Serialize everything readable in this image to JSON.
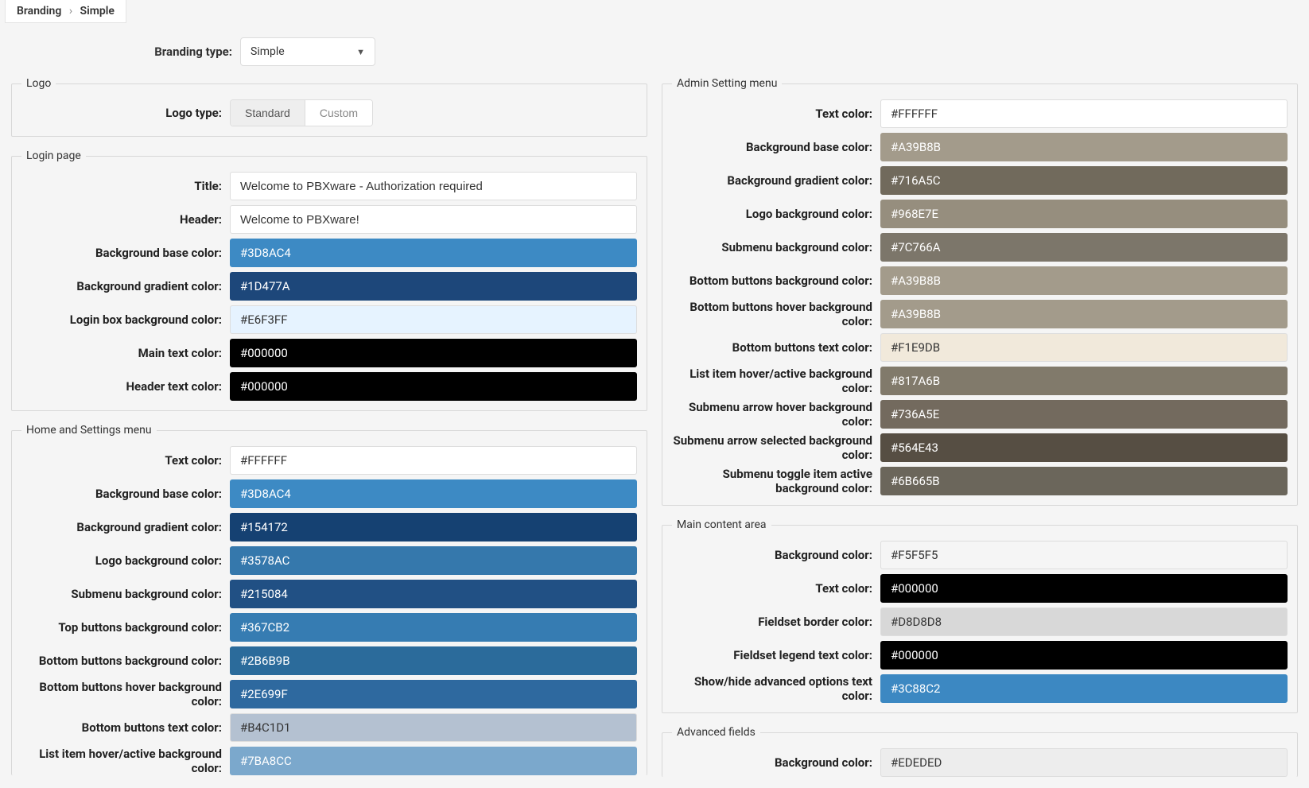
{
  "breadcrumb": {
    "root": "Branding",
    "leaf": "Simple"
  },
  "brandingType": {
    "label": "Branding type:",
    "value": "Simple"
  },
  "logo": {
    "legend": "Logo",
    "typeLabel": "Logo type:",
    "standard": "Standard",
    "custom": "Custom"
  },
  "loginPage": {
    "legend": "Login page",
    "fields": [
      {
        "label": "Title:",
        "type": "text",
        "value": "Welcome to PBXware - Authorization required"
      },
      {
        "label": "Header:",
        "type": "text",
        "value": "Welcome to PBXware!"
      },
      {
        "label": "Background base color:",
        "type": "color",
        "value": "#3D8AC4"
      },
      {
        "label": "Background gradient color:",
        "type": "color",
        "value": "#1D477A"
      },
      {
        "label": "Login box background color:",
        "type": "color",
        "value": "#E6F3FF"
      },
      {
        "label": "Main text color:",
        "type": "color",
        "value": "#000000"
      },
      {
        "label": "Header text color:",
        "type": "color",
        "value": "#000000"
      }
    ]
  },
  "homeMenu": {
    "legend": "Home and Settings menu",
    "fields": [
      {
        "label": "Text color:",
        "type": "color",
        "value": "#FFFFFF"
      },
      {
        "label": "Background base color:",
        "type": "color",
        "value": "#3D8AC4"
      },
      {
        "label": "Background gradient color:",
        "type": "color",
        "value": "#154172"
      },
      {
        "label": "Logo background color:",
        "type": "color",
        "value": "#3578AC"
      },
      {
        "label": "Submenu background color:",
        "type": "color",
        "value": "#215084"
      },
      {
        "label": "Top buttons background color:",
        "type": "color",
        "value": "#367CB2"
      },
      {
        "label": "Bottom buttons background color:",
        "type": "color",
        "value": "#2B6B9B"
      },
      {
        "label": "Bottom buttons hover background color:",
        "type": "color",
        "value": "#2E699F"
      },
      {
        "label": "Bottom buttons text color:",
        "type": "color",
        "value": "#B4C1D1"
      },
      {
        "label": "List item hover/active background color:",
        "type": "color",
        "value": "#7BA8CC"
      }
    ]
  },
  "adminMenu": {
    "legend": "Admin Setting menu",
    "fields": [
      {
        "label": "Text color:",
        "type": "color",
        "value": "#FFFFFF"
      },
      {
        "label": "Background base color:",
        "type": "color",
        "value": "#A39B8B"
      },
      {
        "label": "Background gradient color:",
        "type": "color",
        "value": "#716A5C"
      },
      {
        "label": "Logo background color:",
        "type": "color",
        "value": "#968E7E"
      },
      {
        "label": "Submenu background color:",
        "type": "color",
        "value": "#7C766A"
      },
      {
        "label": "Bottom buttons background color:",
        "type": "color",
        "value": "#A39B8B"
      },
      {
        "label": "Bottom buttons hover background color:",
        "type": "color",
        "value": "#A39B8B"
      },
      {
        "label": "Bottom buttons text color:",
        "type": "color",
        "value": "#F1E9DB"
      },
      {
        "label": "List item hover/active background color:",
        "type": "color",
        "value": "#817A6B"
      },
      {
        "label": "Submenu arrow hover background color:",
        "type": "color",
        "value": "#736A5E"
      },
      {
        "label": "Submenu arrow selected background color:",
        "type": "color",
        "value": "#564E43"
      },
      {
        "label": "Submenu toggle item active background color:",
        "type": "color",
        "value": "#6B665B"
      }
    ]
  },
  "mainContent": {
    "legend": "Main content area",
    "fields": [
      {
        "label": "Background color:",
        "type": "color",
        "value": "#F5F5F5"
      },
      {
        "label": "Text color:",
        "type": "color",
        "value": "#000000"
      },
      {
        "label": "Fieldset border color:",
        "type": "color",
        "value": "#D8D8D8"
      },
      {
        "label": "Fieldset legend text color:",
        "type": "color",
        "value": "#000000"
      },
      {
        "label": "Show/hide advanced options text color:",
        "type": "color",
        "value": "#3C88C2"
      }
    ]
  },
  "advancedFields": {
    "legend": "Advanced fields",
    "fields": [
      {
        "label": "Background color:",
        "type": "color",
        "value": "#EDEDED"
      }
    ]
  }
}
